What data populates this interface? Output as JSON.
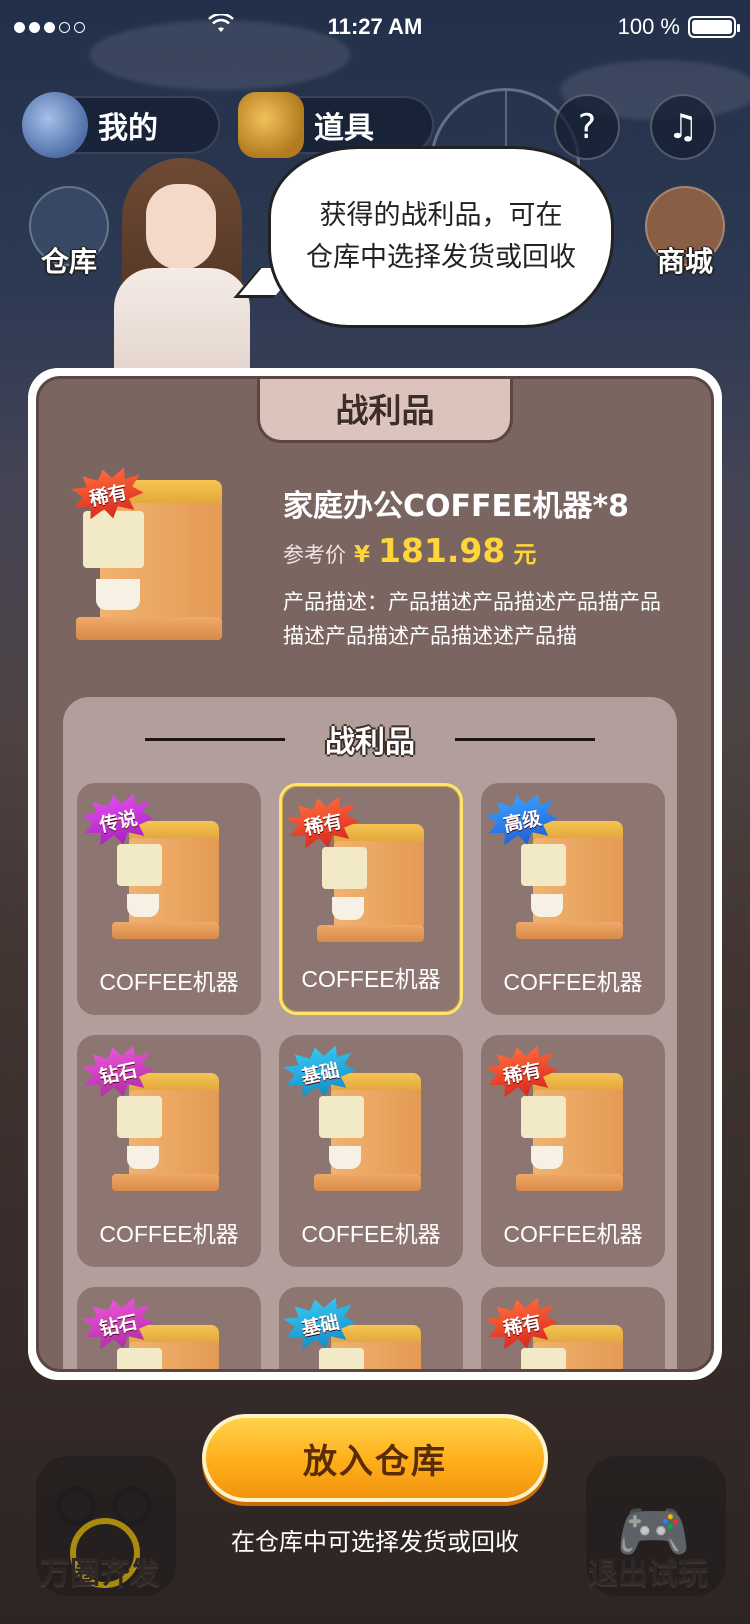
{
  "status_bar": {
    "time": "11:27 AM",
    "battery": "100 %"
  },
  "top_nav": {
    "mine_label": "我的",
    "tools_label": "道具",
    "help_icon": "question-icon",
    "music_icon": "music-note-icon",
    "warehouse_label": "仓库",
    "mall_label": "商城"
  },
  "bubble": {
    "line1": "获得的战利品，可在",
    "line2": "仓库中选择发货或回收"
  },
  "panel": {
    "tab_title": "战利品",
    "featured": {
      "badge": "稀有",
      "title": "家庭办公COFFEE机器*8",
      "price_label": "参考价",
      "price_currency": "¥",
      "price_value": "181.98",
      "price_unit": "元",
      "description": "产品描述：产品描述产品描述产品描产品描述产品描述产品描述述产品描"
    },
    "grid_title": "战利品",
    "items": [
      {
        "badge": "传说",
        "name": "COFFEE机器",
        "rarity": "legend"
      },
      {
        "badge": "稀有",
        "name": "COFFEE机器",
        "rarity": "rare",
        "selected": true
      },
      {
        "badge": "高级",
        "name": "COFFEE机器",
        "rarity": "advanced"
      },
      {
        "badge": "钻石",
        "name": "COFFEE机器",
        "rarity": "diamond"
      },
      {
        "badge": "基础",
        "name": "COFFEE机器",
        "rarity": "basic"
      },
      {
        "badge": "稀有",
        "name": "COFFEE机器",
        "rarity": "rare"
      },
      {
        "badge": "钻石",
        "name": "",
        "rarity": "diamond"
      },
      {
        "badge": "基础",
        "name": "",
        "rarity": "basic"
      },
      {
        "badge": "稀有",
        "name": "",
        "rarity": "rare"
      }
    ]
  },
  "actions": {
    "store_button": "放入仓库",
    "hint": "在仓库中可选择发货或回收"
  },
  "bottom": {
    "left_label": "万圈齐发",
    "right_label": "退出试玩"
  },
  "colors": {
    "panel_bg": "#7a6561",
    "grid_bg": "#b29f9b",
    "card_bg": "#8d7672",
    "price": "#ffd53a",
    "cta": "#ffae1a",
    "selected_border": "#ffe36b"
  }
}
